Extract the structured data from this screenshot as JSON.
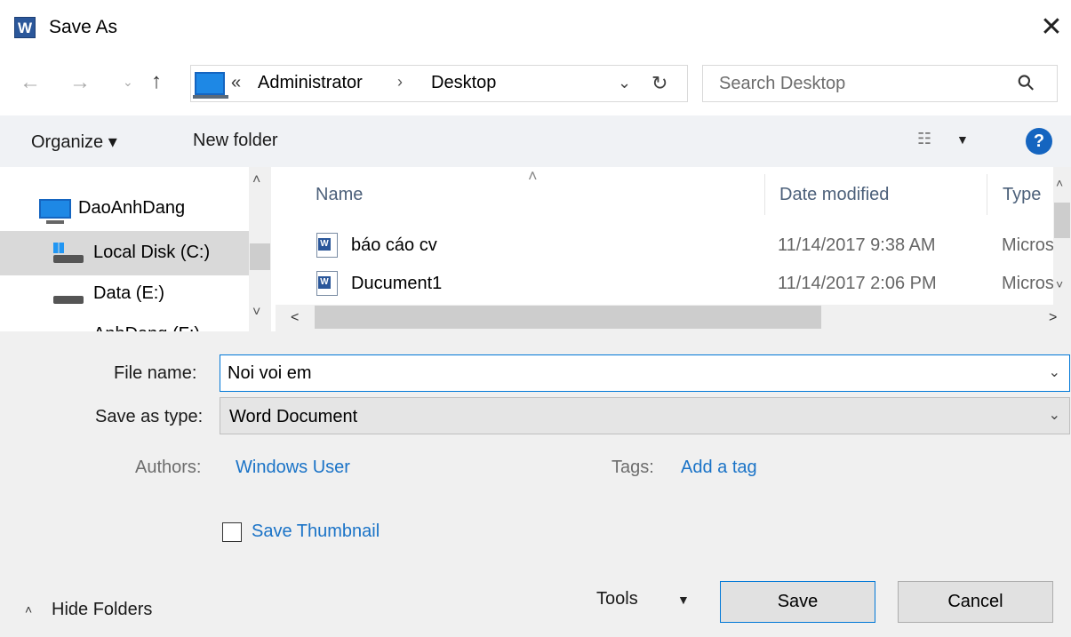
{
  "window": {
    "title": "Save As",
    "app_icon": "word-app-icon",
    "close_glyph": "✕"
  },
  "nav": {
    "back_glyph": "←",
    "forward_glyph": "→",
    "recent_glyph": "⌄",
    "up_glyph": "↑",
    "address": {
      "overflow": "«",
      "crumbs": [
        "Administrator",
        "Desktop"
      ],
      "separator": "›",
      "dropdown_glyph": "⌄",
      "refresh_glyph": "↻"
    },
    "search": {
      "placeholder": "Search Desktop",
      "icon_glyph": "⚲"
    }
  },
  "toolbar": {
    "organize": "Organize ▾",
    "new_folder": "New folder",
    "view_glyph": "☷",
    "view_drop_glyph": "▼",
    "help_glyph": "?"
  },
  "sidebar": {
    "items": [
      {
        "label": "DaoAnhDang",
        "icon": "pc-icon"
      },
      {
        "label": "Local Disk (C:)",
        "icon": "windows-drive-icon"
      },
      {
        "label": "Data (E:)",
        "icon": "drive-icon"
      },
      {
        "label": "AnhDang (F:)",
        "icon": "drive-icon"
      }
    ],
    "scroll_up": "˄",
    "scroll_down": "˅"
  },
  "files": {
    "sort_glyph": "˄",
    "columns": {
      "name": "Name",
      "date": "Date modified",
      "type": "Type"
    },
    "rows": [
      {
        "name": "báo cáo cv",
        "date": "11/14/2017 9:38 AM",
        "type": "Microsoft Word Document"
      },
      {
        "name": "Ducument1",
        "date": "11/14/2017 2:06 PM",
        "type": "Microsoft Word Document"
      }
    ],
    "vscroll_up": "˄",
    "vscroll_down": "˅",
    "hscroll_left": "<",
    "hscroll_right": ">"
  },
  "form": {
    "file_name_label": "File name:",
    "file_name_value": "Noi voi em",
    "save_type_label": "Save as type:",
    "save_type_value": "Word Document",
    "dropdown_glyph": "⌄",
    "authors_label": "Authors:",
    "authors_value": "Windows User",
    "tags_label": "Tags:",
    "tags_value": "Add a tag",
    "thumbnail_label": "Save Thumbnail",
    "thumbnail_checked": false
  },
  "footer": {
    "hide_folders": "Hide Folders",
    "hide_glyph": "˄",
    "tools": "Tools",
    "tools_drop_glyph": "▼",
    "save": "Save",
    "cancel": "Cancel"
  },
  "colors": {
    "accent": "#0078d7",
    "link": "#1a73c7",
    "header": "#4c607a",
    "panel": "#f0f0f0"
  }
}
